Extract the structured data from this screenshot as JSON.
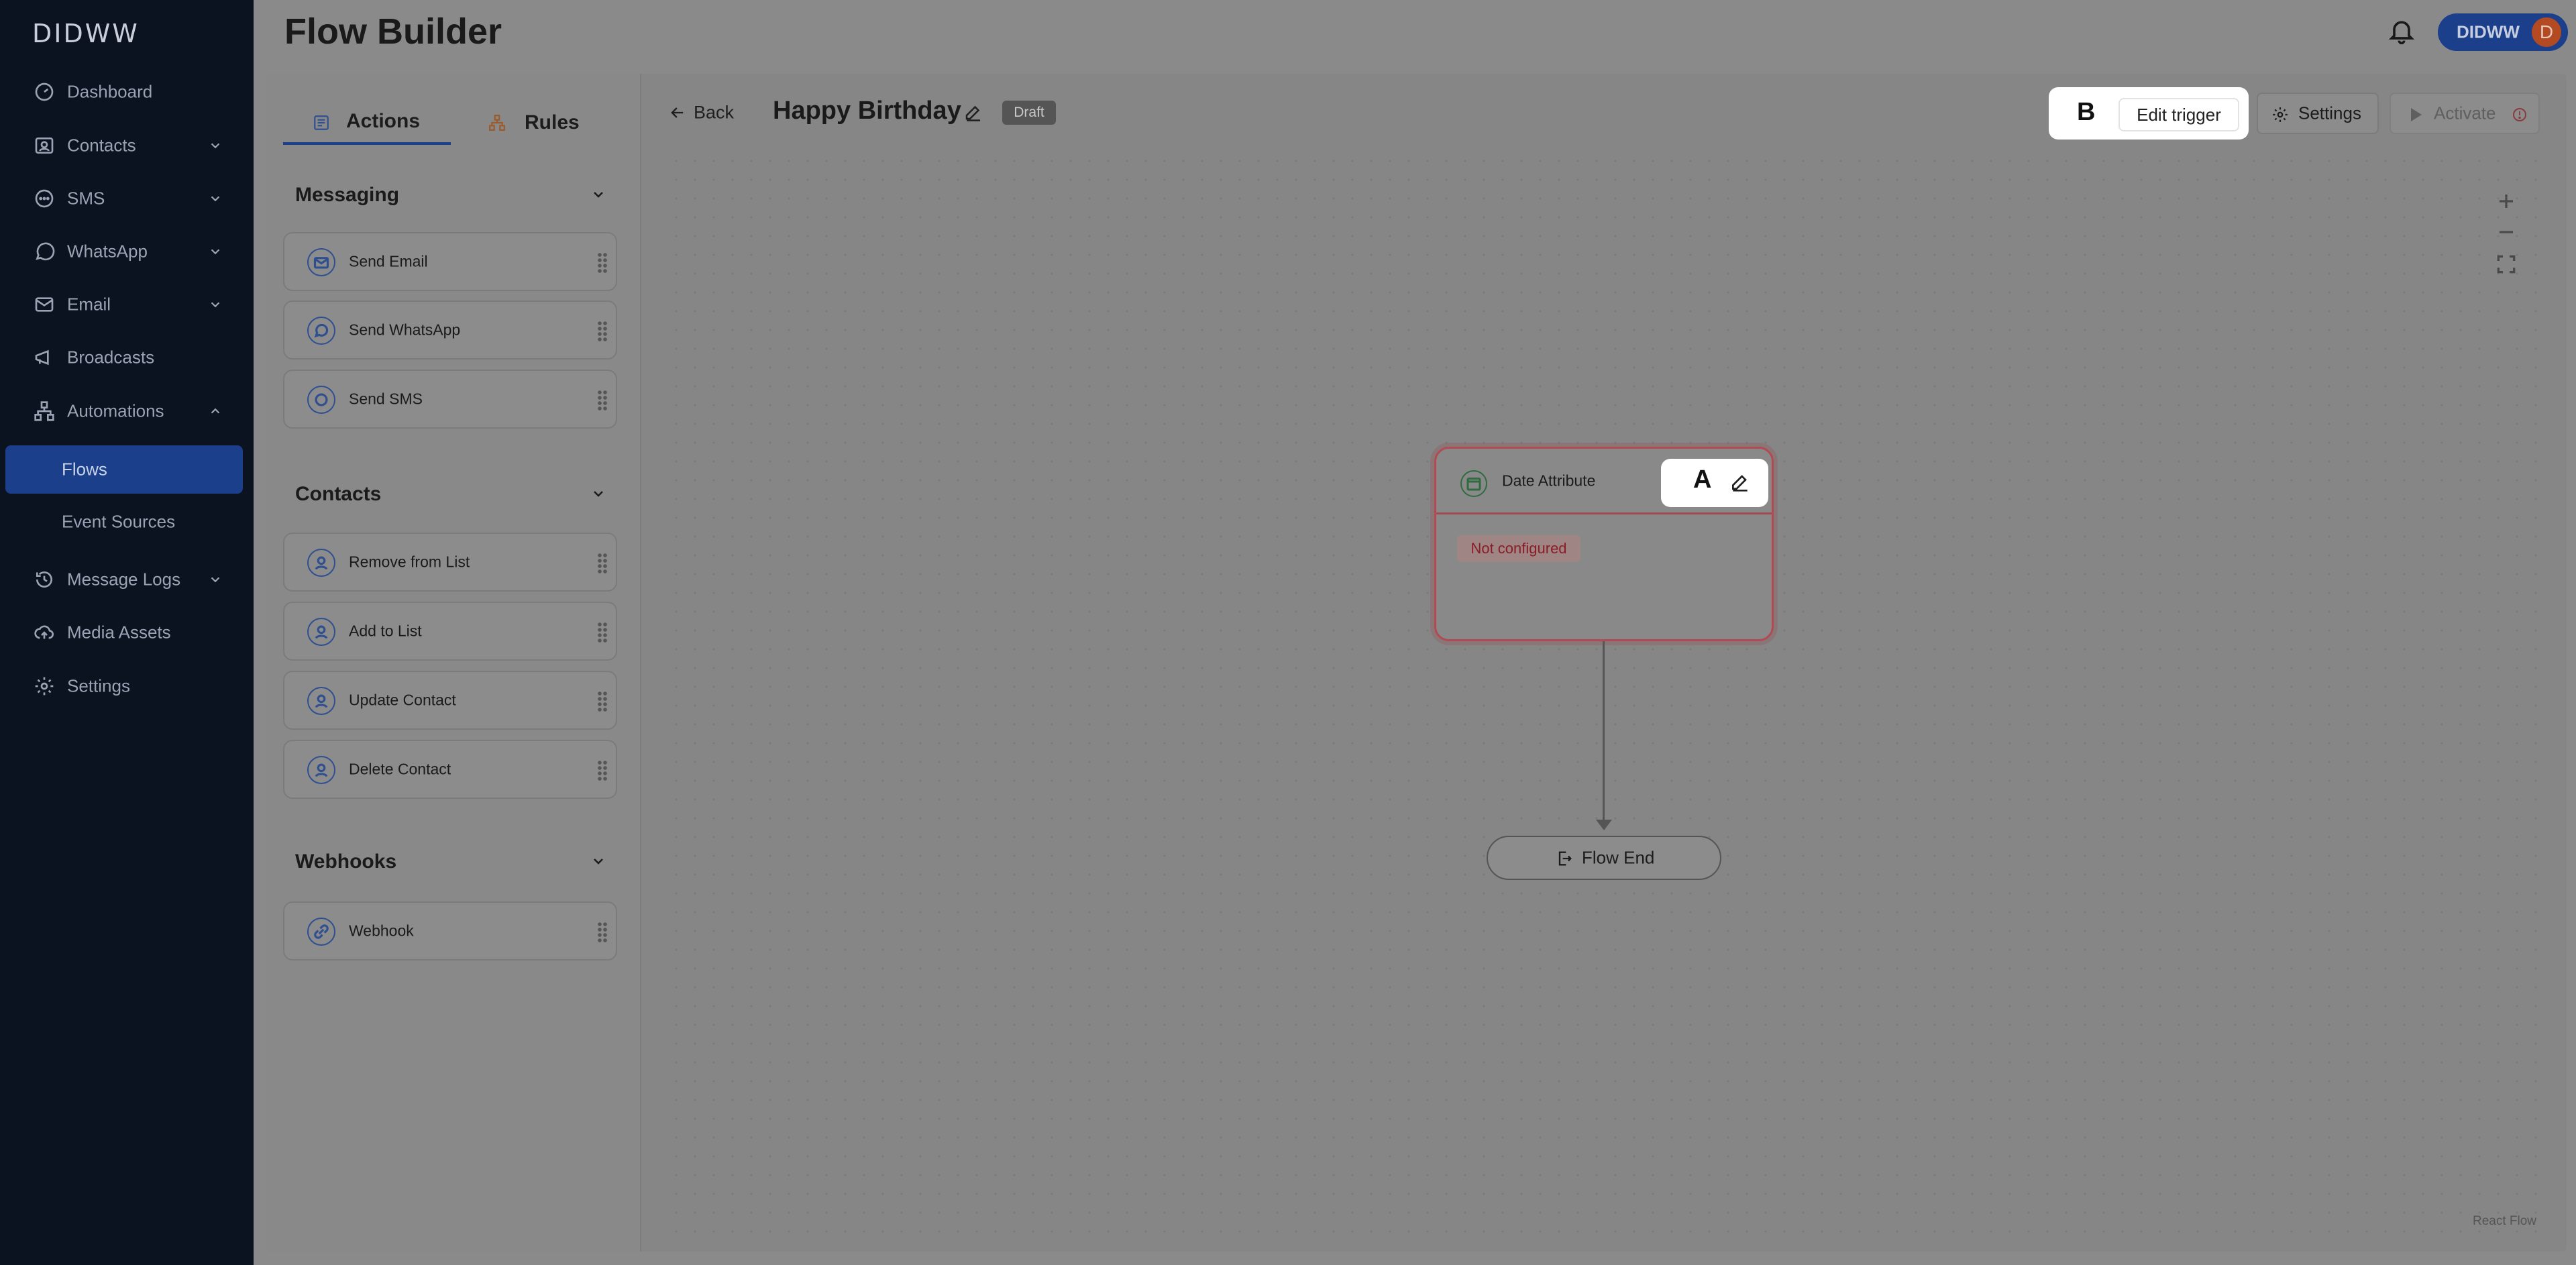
{
  "app": {
    "logo": "DIDWW"
  },
  "sidebar": {
    "items": [
      {
        "label": "Dashboard",
        "icon": "dashboard-icon"
      },
      {
        "label": "Contacts",
        "icon": "contacts-icon",
        "expandable": true
      },
      {
        "label": "SMS",
        "icon": "sms-icon",
        "expandable": true
      },
      {
        "label": "WhatsApp",
        "icon": "whatsapp-icon",
        "expandable": true
      },
      {
        "label": "Email",
        "icon": "mail-icon",
        "expandable": true
      },
      {
        "label": "Broadcasts",
        "icon": "megaphone-icon"
      },
      {
        "label": "Automations",
        "icon": "automations-icon",
        "expanded": true
      },
      {
        "label": "Message Logs",
        "icon": "history-icon",
        "expandable": true
      },
      {
        "label": "Media Assets",
        "icon": "cloud-upload-icon"
      },
      {
        "label": "Settings",
        "icon": "gear-icon"
      }
    ],
    "sub_items": [
      {
        "label": "Flows",
        "active": true
      },
      {
        "label": "Event Sources",
        "active": false
      }
    ]
  },
  "header": {
    "title": "Flow Builder",
    "user_name": "DIDWW",
    "user_initial": "D"
  },
  "palette": {
    "tabs": [
      {
        "label": "Actions",
        "active": true
      },
      {
        "label": "Rules",
        "active": false
      }
    ],
    "sections": [
      {
        "title": "Messaging",
        "items": [
          "Send Email",
          "Send WhatsApp",
          "Send SMS"
        ]
      },
      {
        "title": "Contacts",
        "items": [
          "Remove from List",
          "Add to List",
          "Update Contact",
          "Delete Contact"
        ]
      },
      {
        "title": "Webhooks",
        "items": [
          "Webhook"
        ]
      }
    ]
  },
  "toolbar": {
    "back_label": "Back",
    "flow_name": "Happy Birthday",
    "status_badge": "Draft",
    "edit_trigger_label": "Edit trigger",
    "settings_label": "Settings",
    "activate_label": "Activate"
  },
  "callouts": {
    "a": "A",
    "b": "B"
  },
  "canvas": {
    "trigger_node": {
      "title": "Date Attribute",
      "status": "Not configured"
    },
    "end_node": {
      "label": "Flow End"
    },
    "attribution": "React Flow"
  },
  "colors": {
    "sidebar_bg": "#0b1220",
    "accent": "#1b3f8a",
    "error": "#b14a52"
  }
}
